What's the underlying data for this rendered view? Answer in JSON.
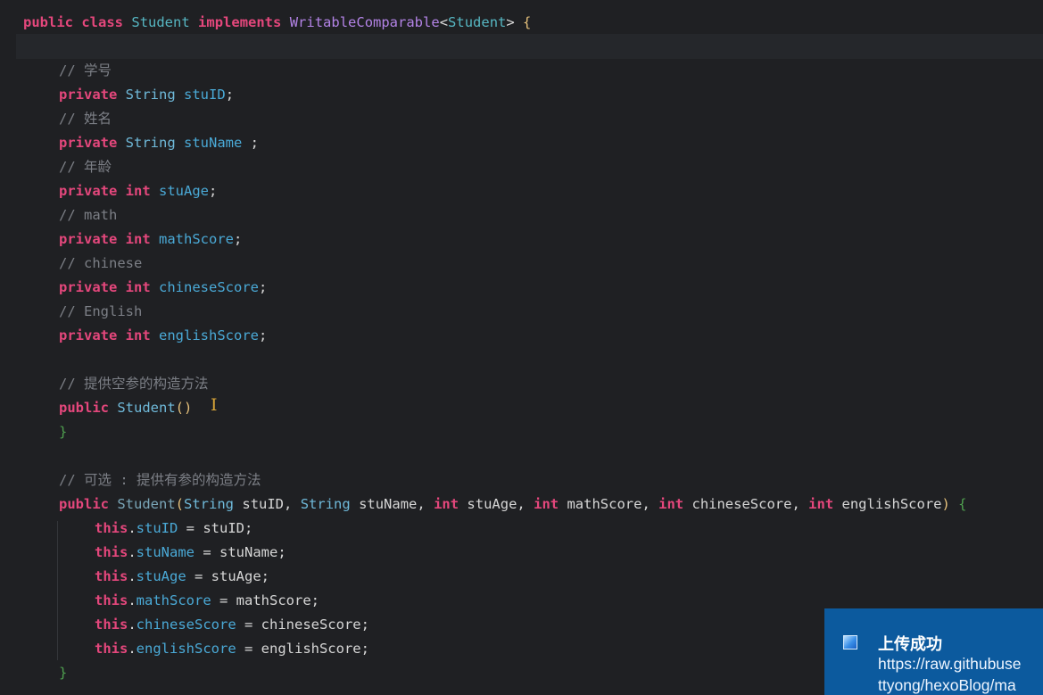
{
  "editor": {
    "class_decl": {
      "public": "public",
      "class": "class",
      "name": "Student",
      "implements": "implements",
      "iface": "WritableComparable",
      "lt": "<",
      "generic": "Student",
      "gt": ">",
      "brace": "{"
    },
    "fields": [
      {
        "comment": "// 学号",
        "modifier": "private",
        "type": "String",
        "name": "stuID",
        "end": ";"
      },
      {
        "comment": "// 姓名",
        "modifier": "private",
        "type": "String",
        "name": "stuName",
        "end": " ;"
      },
      {
        "comment": "// 年龄",
        "modifier": "private",
        "type": "int",
        "name": "stuAge",
        "end": ";"
      },
      {
        "comment": "// math",
        "modifier": "private",
        "type": "int",
        "name": "mathScore",
        "end": ";"
      },
      {
        "comment": "// chinese",
        "modifier": "private",
        "type": "int",
        "name": "chineseScore",
        "end": ";"
      },
      {
        "comment": "// English",
        "modifier": "private",
        "type": "int",
        "name": "englishScore",
        "end": ";"
      }
    ],
    "ctor_empty": {
      "comment": "// 提供空参的构造方法",
      "public": "public",
      "name": "Student",
      "parens": "()",
      "close": "}"
    },
    "cursor_glyph": "I",
    "ctor_full": {
      "comment": "// 可选 : 提供有参的构造方法",
      "public": "public",
      "name": "Student",
      "open_paren": "(",
      "params": [
        {
          "type": "String",
          "name": "stuID"
        },
        {
          "type": "String",
          "name": "stuName"
        },
        {
          "type": "int",
          "name": "stuAge"
        },
        {
          "type": "int",
          "name": "mathScore"
        },
        {
          "type": "int",
          "name": "chineseScore"
        },
        {
          "type": "int",
          "name": "englishScore"
        }
      ],
      "comma": ",",
      "close_paren": ")",
      "brace": "{",
      "assignments": [
        {
          "this": "this",
          "field": "stuID",
          "value": "stuID"
        },
        {
          "this": "this",
          "field": "stuName",
          "value": "stuName"
        },
        {
          "this": "this",
          "field": "stuAge",
          "value": "stuAge"
        },
        {
          "this": "this",
          "field": "mathScore",
          "value": "mathScore"
        },
        {
          "this": "this",
          "field": "chineseScore",
          "value": "chineseScore"
        },
        {
          "this": "this",
          "field": "englishScore",
          "value": "englishScore"
        }
      ],
      "close": "}"
    }
  },
  "toast": {
    "icon": "upload-success-icon",
    "title": "上传成功",
    "line1": "https://raw.githubuse",
    "line2": "ttyong/hexoBlog/ma"
  }
}
